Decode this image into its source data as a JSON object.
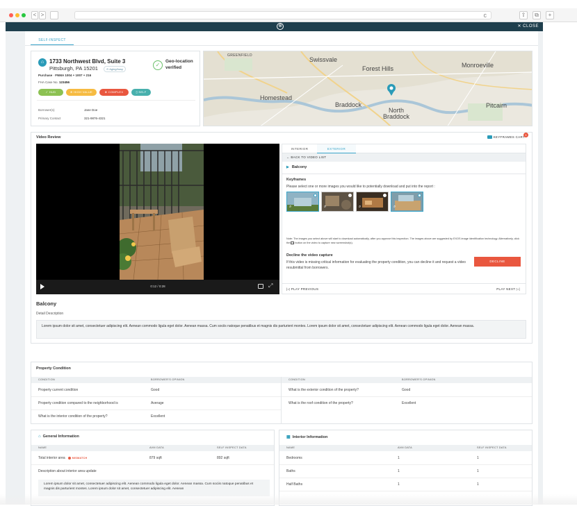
{
  "browser": {
    "traffic_colors": [
      "#ff5f57",
      "#febc2e",
      "#28c840"
    ],
    "back": "<",
    "forward": ">",
    "reload": "c"
  },
  "topbar": {
    "close_label": "✕ CLOSE"
  },
  "tabs": {
    "self_inspect": "SELF-INSPECT"
  },
  "property": {
    "address_line1": "1733 Northwest Blvd, Suite 3",
    "address_line2": "Pittsburgh, PA 15201",
    "aging_badge": "⊙ Aging/busy",
    "geo_status": "Geo-location verified",
    "purchase_label": "Purchase",
    "purchase_value": "FNMA 1004 + 1007 + 216",
    "fha_label": "FHA Case No.",
    "fha_value": "123456",
    "badges": [
      "✓ HUD",
      "⊕ HIGH VALUE",
      "⊗ COMPLEX",
      "▯ SELF"
    ],
    "borrowers_label": "Borrower(s)",
    "borrowers_value": "Jane Doe",
    "contact_label": "Primary Contact",
    "contact_value": "321-9876-4321"
  },
  "map": {
    "labels": [
      "GREENFIELD",
      "Swissvale",
      "Forest Hills",
      "Monroeville",
      "Homestead",
      "Braddock",
      "North Braddock",
      "Pitcairn"
    ]
  },
  "video": {
    "title": "Video Review",
    "keyframes_cart": "KEYFRAMES CART",
    "cart_count": "3",
    "time": "0:12 / 0:28",
    "tabs": [
      "INTERIOR",
      "EXTERIOR"
    ],
    "back_label": "← BACK TO VIDEO LIST",
    "video_name": "Balcony",
    "keyframes_title": "Keyframes",
    "keyframes_desc": "Please select one or more images you would like to potentially download and put into the report :",
    "note": "Note: The images you select above will start to download automatically, after you approve this inspection. The images above are suggested by EXOS image identification technology. Alternatively, click the",
    "note_tail": "button on the video to capture new screenshot(s).",
    "decline_title": "Decline the video capture",
    "decline_desc": "If this video is missing critical information for evaluating the property condition, you can decline it and request a video resubmittal from borrowers.",
    "decline_button": "DECLINE",
    "play_previous": "|◁ PLAY PREVIOUS",
    "play_next": "PLAY NEXT ▷|"
  },
  "detail": {
    "title": "Balcony",
    "subtitle": "Detail Description",
    "text": "Lorem ipsum dolor sit amet, consectetuer adipiscing elit. Aenean commodo ligula eget dolor. Aenean massa. Cum sociis natoque penatibus et magnis dis parturient montes. Lorem ipsum dolor sit amet, consectetuer adipiscing elit. Aenean commodo ligula eget dolor. Aenean massa."
  },
  "condition": {
    "title": "Property Condition",
    "headers": [
      "CONDITION",
      "BORROWER'S OPINION",
      "CONDITION",
      "BORROWER'S OPINION"
    ],
    "left_rows": [
      [
        "Property current condition",
        "Good"
      ],
      [
        "Property condition compared to the neighborhood is",
        "Average"
      ],
      [
        "What is the interior condition of the property?",
        "Excellent"
      ]
    ],
    "right_rows": [
      [
        "What is the exterior condition of the property?",
        "Good"
      ],
      [
        "What is the roof condition of the property?",
        "Excellent"
      ]
    ]
  },
  "general": {
    "title": "General Information",
    "headers": [
      "NAME",
      "AVM DATA",
      "SELF INSPECT DATA"
    ],
    "row1": [
      "Total interior area",
      "879 sqft",
      "892 sqft"
    ],
    "mismatch": "MISMATCH",
    "desc_label": "Description about interior area update",
    "desc_text": "Lorem ipsum dolor sit amet, consectetuer adipiscing elit. Aenean commodo ligula eget dolor. Aenean massa. Cum sociis natoque penatibus et magnis dis parturient montes. Lorem ipsum dolor sit amet, consectetuer adipiscing elit. Aenean"
  },
  "interior": {
    "title": "Interior Information",
    "headers": [
      "NAME",
      "AVM DATA",
      "SELF INSPECT DATA"
    ],
    "rows": [
      [
        "Bedrooms",
        "1",
        "1"
      ],
      [
        "Baths",
        "1",
        "1"
      ],
      [
        "Half Baths",
        "1",
        "1"
      ]
    ]
  },
  "colors": {
    "accent": "#3aa5c9",
    "topbar": "#1f3f4d",
    "decline": "#e9573f",
    "mismatch": "#e9573f"
  }
}
